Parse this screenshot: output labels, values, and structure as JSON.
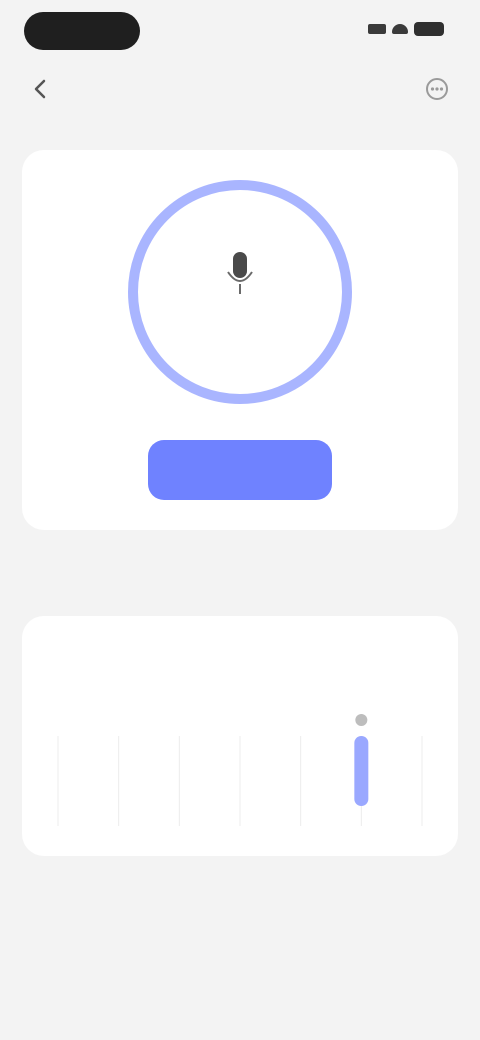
{
  "nav": {
    "title": ""
  },
  "timer": {
    "value": "",
    "left_button": "",
    "primary_button": "",
    "right_button": ""
  },
  "section": {
    "title": ""
  },
  "stats": {
    "label": "",
    "sublabel": "",
    "right_value": "",
    "note": ""
  },
  "colors": {
    "accent": "#6f82ff",
    "ring": "#a9b5ff",
    "background": "#f3f3f3",
    "card": "#ffffff"
  },
  "chart_data": {
    "type": "bar",
    "categories": [
      "",
      "",
      "",
      "",
      "",
      "",
      ""
    ],
    "values": [
      0,
      0,
      0,
      0,
      0,
      1,
      0
    ],
    "highlight_index": 5,
    "grid": true
  }
}
